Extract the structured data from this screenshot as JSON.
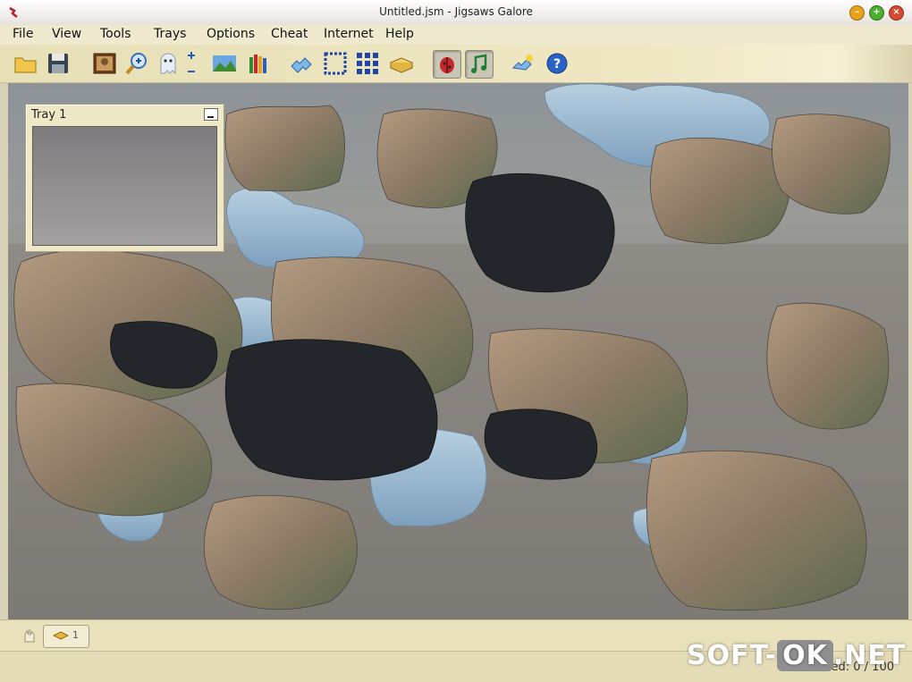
{
  "window": {
    "title": "Untitled.jsm - Jigsaws Galore"
  },
  "menu": [
    "File",
    "View",
    "Tools",
    "Trays",
    "Options",
    "Cheat",
    "Internet",
    "Help"
  ],
  "toolbar": {
    "icons": [
      "open-folder-icon",
      "save-disk-icon",
      "picture-icon",
      "zoom-icon",
      "ghost-icon",
      "scale-icon",
      "landscape-icon",
      "crayons-icon",
      "pieces-icon",
      "select-edges-icon",
      "grid-icon",
      "tray-box-icon",
      "bug-icon",
      "music-note-icon",
      "hint-icon",
      "help-icon"
    ]
  },
  "tray": {
    "title": "Tray 1"
  },
  "bottom": {
    "count": "1"
  },
  "status": {
    "text": "Solved: 0 / 100"
  },
  "watermark": {
    "pre": "SOFT-",
    "box": "OK",
    "post": ".NET"
  },
  "colors": {
    "menu_bg": "#efe9cf",
    "toolbar_bg": "#e7dfb6",
    "tray_bg": "#efe8c6"
  }
}
